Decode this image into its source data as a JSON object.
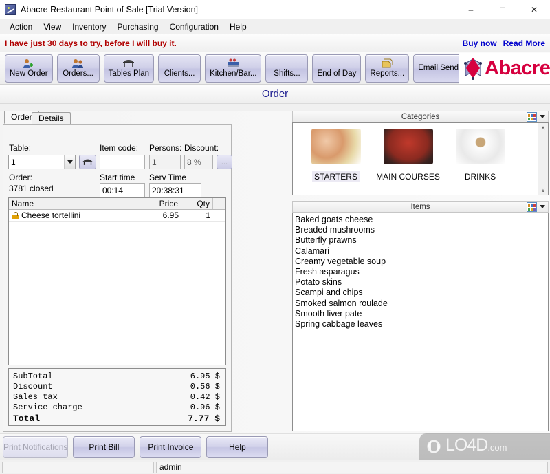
{
  "window": {
    "title": "Abacre Restaurant Point of Sale [Trial Version]",
    "icon": "app-icon",
    "minimize": "–",
    "maximize": "□",
    "close": "✕"
  },
  "menubar": {
    "items": [
      {
        "label": "Action"
      },
      {
        "label": "View"
      },
      {
        "label": "Inventory"
      },
      {
        "label": "Purchasing"
      },
      {
        "label": "Configuration"
      },
      {
        "label": "Help"
      }
    ]
  },
  "trial": {
    "message": "I have just 30 days to try, before I will buy it.",
    "buy_label": "Buy now",
    "read_label": "Read More",
    "text_color": "#b00000",
    "link_color": "#0000cc"
  },
  "toolbar": {
    "buttons": [
      {
        "label": "New Order",
        "icon": "new-order-icon"
      },
      {
        "label": "Orders...",
        "icon": "orders-icon"
      },
      {
        "label": "Tables Plan",
        "icon": "tables-plan-icon"
      },
      {
        "label": "Clients...",
        "icon": "clients-icon"
      },
      {
        "label": "Kitchen/Bar...",
        "icon": "kitchen-bar-icon"
      },
      {
        "label": "Shifts...",
        "icon": "shifts-icon"
      },
      {
        "label": "End of Day",
        "icon": "end-of-day-icon"
      },
      {
        "label": "Reports...",
        "icon": "reports-icon"
      },
      {
        "label": "Email Sender",
        "icon": "email-sender-icon"
      }
    ],
    "logo_text": "Abacre",
    "logo_color": "#d6003f"
  },
  "page": {
    "title": "Order",
    "title_color": "#1b1b8f"
  },
  "tabs": [
    {
      "label": "Order",
      "active": true
    },
    {
      "label": "Details",
      "active": false
    }
  ],
  "form": {
    "table_label": "Table:",
    "table_value": "1",
    "table_picker_icon": "table-icon",
    "item_code_label": "Item code:",
    "item_code_value": "",
    "persons_label": "Persons:",
    "persons_value": "1",
    "discount_label": "Discount:",
    "discount_value": "8 %",
    "discount_more_label": "...",
    "order_label": "Order:",
    "order_value": "3781 closed",
    "start_time_label": "Start time",
    "start_time_value": "00:14",
    "serv_time_label": "Serv Time",
    "serv_time_value": "20:38:31"
  },
  "order_grid": {
    "columns": [
      "Name",
      "Price",
      "Qty"
    ],
    "rows": [
      {
        "icon": "lock-icon",
        "name": "Cheese tortellini",
        "price": "6.95",
        "qty": "1"
      }
    ]
  },
  "totals": {
    "rows": [
      {
        "label": "SubTotal",
        "value": "6.95 $"
      },
      {
        "label": "Discount",
        "value": "0.56 $"
      },
      {
        "label": "Sales tax",
        "value": "0.42 $"
      },
      {
        "label": "Service charge",
        "value": "0.96 $"
      }
    ],
    "grand_label": "Total",
    "grand_value": "7.77 $"
  },
  "categories_panel": {
    "title": "Categories",
    "view_icon": "grid-view-icon",
    "items": [
      {
        "label": "STARTERS",
        "selected": true,
        "image": "starters-photo"
      },
      {
        "label": "MAIN COURSES",
        "selected": false,
        "image": "main-courses-photo"
      },
      {
        "label": "DRINKS",
        "selected": false,
        "image": "drinks-photo"
      }
    ],
    "scroll_up": "∧",
    "scroll_down": "∨"
  },
  "items_panel": {
    "title": "Items",
    "view_icon": "grid-view-icon",
    "items": [
      "Baked goats cheese",
      "Breaded mushrooms",
      "Butterfly prawns",
      "Calamari",
      "Creamy vegetable soup",
      "Fresh asparagus",
      "Potato skins",
      "Scampi and chips",
      "Smoked salmon roulade",
      "Smooth liver pate",
      "Spring cabbage leaves"
    ]
  },
  "bottom_buttons": [
    {
      "label": "Print Notifications",
      "disabled": true
    },
    {
      "label": "Print Bill",
      "disabled": false
    },
    {
      "label": "Print Invoice",
      "disabled": false
    },
    {
      "label": "Help",
      "disabled": false
    }
  ],
  "statusbar": {
    "pane1": "",
    "pane2": "admin"
  },
  "watermark": {
    "text": "LO4D",
    "suffix": ".com",
    "icon": "refresh-circle-icon"
  }
}
